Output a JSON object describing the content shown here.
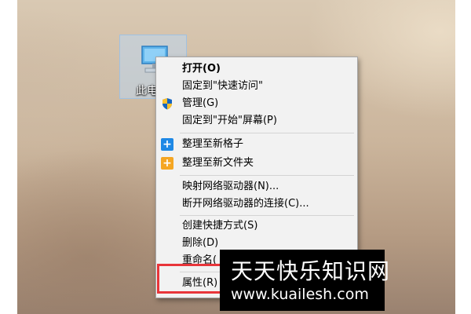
{
  "desktop_icon": {
    "label": "此电",
    "icon": "computer-icon"
  },
  "context_menu": {
    "items": [
      {
        "label": "打开(O)",
        "bold": true
      },
      {
        "label": "固定到\"快速访问\""
      },
      {
        "label": "管理(G)",
        "icon": "uac-shield-icon"
      },
      {
        "label": "固定到\"开始\"屏幕(P)"
      },
      {
        "label": "整理至新格子",
        "icon": "blue-plus-icon"
      },
      {
        "label": "整理至新文件夹",
        "icon": "yellow-plus-icon"
      },
      {
        "label": "映射网络驱动器(N)..."
      },
      {
        "label": "断开网络驱动器的连接(C)..."
      },
      {
        "label": "创建快捷方式(S)"
      },
      {
        "label": "删除(D)"
      },
      {
        "label": "重命名("
      },
      {
        "label": "属性(R)"
      }
    ]
  },
  "highlight": {
    "target": "属性(R)",
    "color": "#e8353a"
  },
  "watermark": {
    "title": "天天快乐知识网",
    "url": "www.kuailesh.com"
  },
  "colors": {
    "menu_bg": "#f2f2f2",
    "blue_tile": "#1e88e5",
    "yellow_tile": "#f5a623",
    "shield_blue": "#1565c0",
    "shield_yellow": "#fbc02d"
  }
}
